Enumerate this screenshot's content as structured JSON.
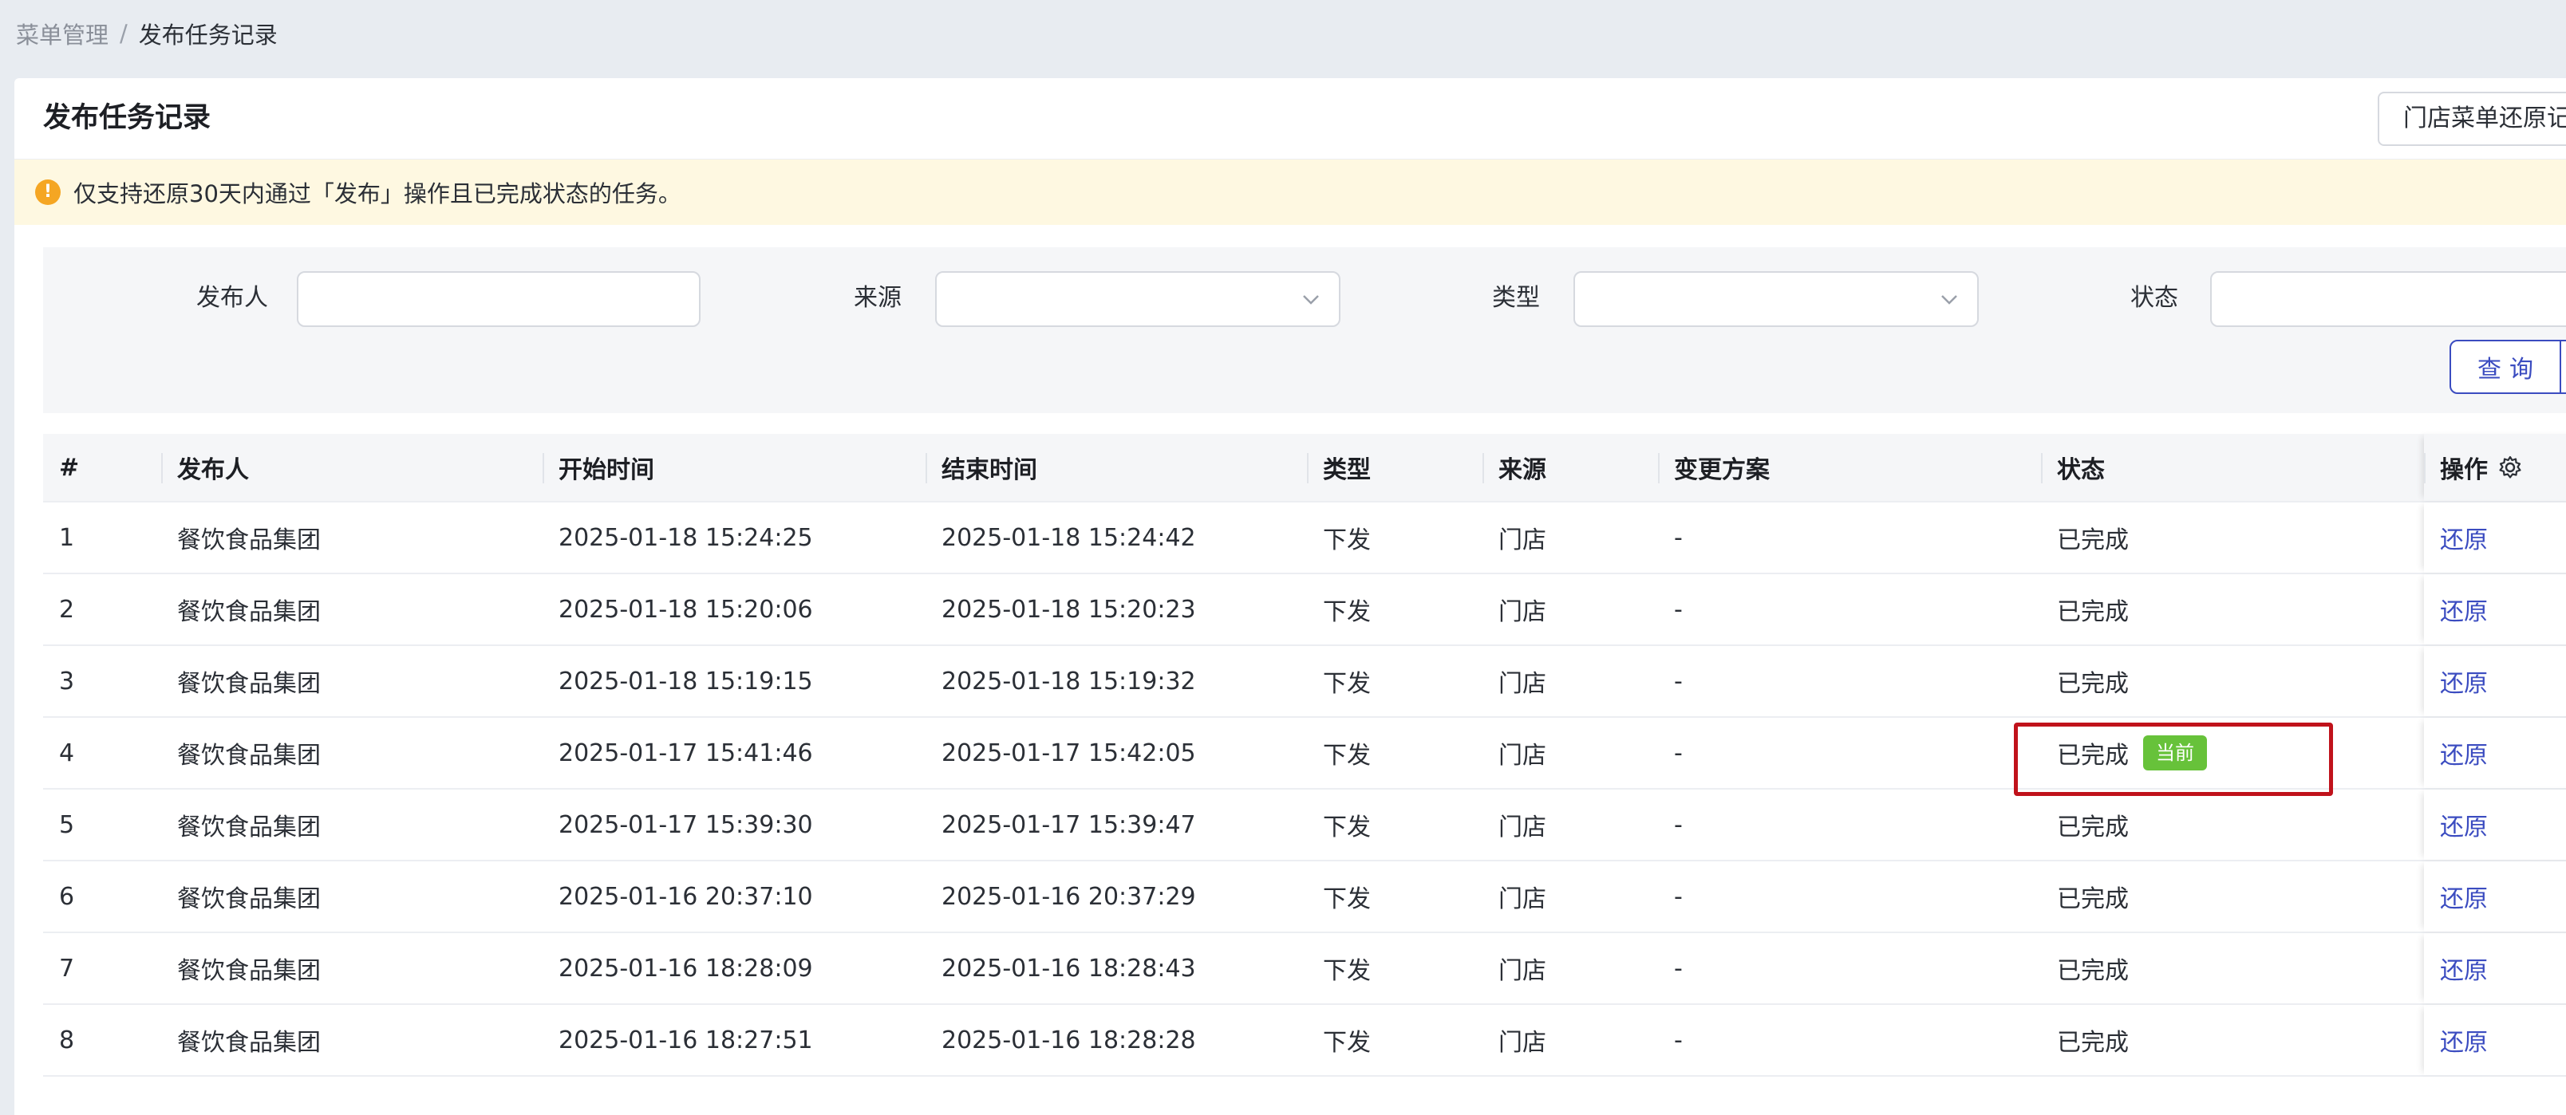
{
  "breadcrumb": {
    "parent": "菜单管理",
    "separator": "/",
    "current": "发布任务记录"
  },
  "header": {
    "title": "发布任务记录",
    "restore_record_button": "门店菜单还原记"
  },
  "notice": {
    "icon": "warning-icon",
    "icon_glyph": "!",
    "text": "仅支持还原30天内通过「发布」操作且已完成状态的任务。"
  },
  "filters": {
    "publisher": {
      "label": "发布人",
      "value": ""
    },
    "source": {
      "label": "来源",
      "value": ""
    },
    "type": {
      "label": "类型",
      "value": ""
    },
    "status": {
      "label": "状态",
      "value": ""
    },
    "query_button": "查询"
  },
  "table": {
    "columns": [
      "#",
      "发布人",
      "开始时间",
      "结束时间",
      "类型",
      "来源",
      "变更方案",
      "状态",
      "操作"
    ],
    "rows": [
      {
        "index": "1",
        "publisher": "餐饮食品集团",
        "start": "2025-01-18 15:24:25",
        "end": "2025-01-18 15:24:42",
        "type": "下发",
        "source": "门店",
        "plan": "-",
        "status": "已完成",
        "action": "还原"
      },
      {
        "index": "2",
        "publisher": "餐饮食品集团",
        "start": "2025-01-18 15:20:06",
        "end": "2025-01-18 15:20:23",
        "type": "下发",
        "source": "门店",
        "plan": "-",
        "status": "已完成",
        "action": "还原"
      },
      {
        "index": "3",
        "publisher": "餐饮食品集团",
        "start": "2025-01-18 15:19:15",
        "end": "2025-01-18 15:19:32",
        "type": "下发",
        "source": "门店",
        "plan": "-",
        "status": "已完成",
        "action": "还原"
      },
      {
        "index": "4",
        "publisher": "餐饮食品集团",
        "start": "2025-01-17 15:41:46",
        "end": "2025-01-17 15:42:05",
        "type": "下发",
        "source": "门店",
        "plan": "-",
        "status": "已完成",
        "tag": "当前",
        "action": "还原"
      },
      {
        "index": "5",
        "publisher": "餐饮食品集团",
        "start": "2025-01-17 15:39:30",
        "end": "2025-01-17 15:39:47",
        "type": "下发",
        "source": "门店",
        "plan": "-",
        "status": "已完成",
        "action": "还原"
      },
      {
        "index": "6",
        "publisher": "餐饮食品集团",
        "start": "2025-01-16 20:37:10",
        "end": "2025-01-16 20:37:29",
        "type": "下发",
        "source": "门店",
        "plan": "-",
        "status": "已完成",
        "action": "还原"
      },
      {
        "index": "7",
        "publisher": "餐饮食品集团",
        "start": "2025-01-16 18:28:09",
        "end": "2025-01-16 18:28:43",
        "type": "下发",
        "source": "门店",
        "plan": "-",
        "status": "已完成",
        "action": "还原"
      },
      {
        "index": "8",
        "publisher": "餐饮食品集团",
        "start": "2025-01-16 18:27:51",
        "end": "2025-01-16 18:28:28",
        "type": "下发",
        "source": "门店",
        "plan": "-",
        "status": "已完成",
        "action": "还原"
      }
    ]
  },
  "colors": {
    "accent": "#3b4cc0",
    "current_tag": "#67c23a",
    "notice_bg": "#fef8e1",
    "highlight": "#c0121b"
  }
}
